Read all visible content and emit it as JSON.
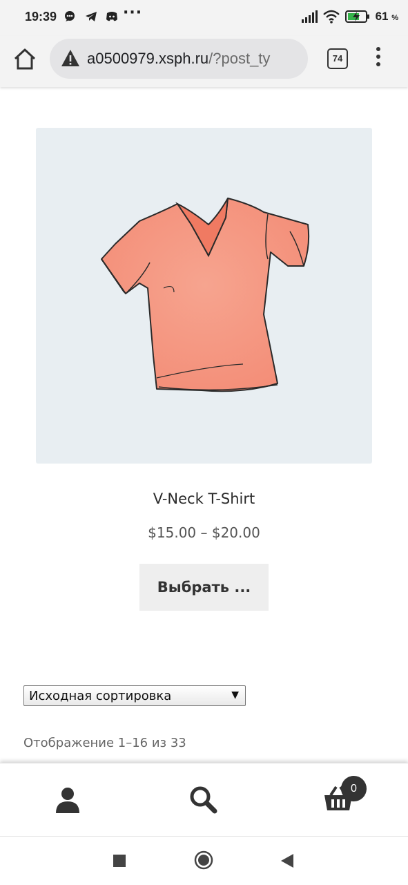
{
  "status_bar": {
    "time": "19:39",
    "battery_percent": "61",
    "battery_unit": "%",
    "icons": [
      "chat-bubble-icon",
      "telegram-icon",
      "discord-icon",
      "more-notifications-icon",
      "signal-icon",
      "wifi-icon",
      "battery-charging-icon"
    ]
  },
  "browser": {
    "url_domain": "a0500979.xsph.ru",
    "url_path": "/?post_ty",
    "tab_count": "74"
  },
  "product": {
    "title": "V-Neck T-Shirt",
    "price": "$15.00 – $20.00",
    "button_label": "Выбрать ...",
    "image_alt_icon": "tshirt-illustration"
  },
  "sorting": {
    "selected": "Исходная сортировка"
  },
  "result_count": "Отображение 1–16 из 33",
  "footer": {
    "cart_count": "0",
    "items": [
      "account-icon",
      "search-icon",
      "cart-icon"
    ]
  },
  "colors": {
    "image_bg": "#e8eef2",
    "button_bg": "#eeeeee",
    "shirt": "#f59a86"
  }
}
